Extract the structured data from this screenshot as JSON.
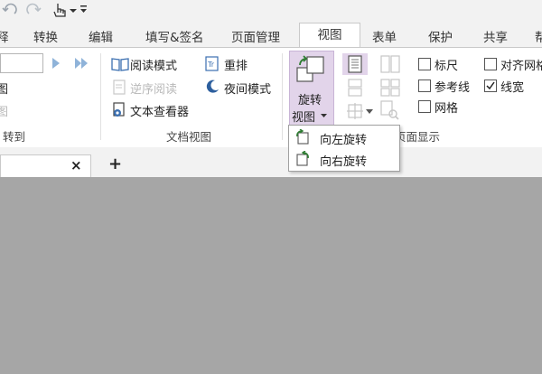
{
  "quick_access": {
    "icons": [
      "undo-icon",
      "redo-icon",
      "hand-tool-icon",
      "customize-arrow-icon"
    ]
  },
  "tabs": [
    {
      "label": "释"
    },
    {
      "label": "转换"
    },
    {
      "label": "编辑"
    },
    {
      "label": "填写&签名"
    },
    {
      "label": "页面管理"
    },
    {
      "label": "视图",
      "active": true
    },
    {
      "label": "表单"
    },
    {
      "label": "保护"
    },
    {
      "label": "共享"
    },
    {
      "label": "帮"
    }
  ],
  "ribbon": {
    "goto": {
      "page_input_value": "",
      "item1": "图",
      "item2": "图",
      "group_label": "转到"
    },
    "doc_view": {
      "read_mode": "阅读模式",
      "reverse_read": "逆序阅读",
      "text_viewer": "文本查看器",
      "reflow": "重排",
      "night_mode": "夜间模式",
      "group_label": "文档视图"
    },
    "rotate": {
      "label_line1": "旋转",
      "label_line2": "视图"
    },
    "page_display": {
      "group_label": "页面显示",
      "ruler": "标尺",
      "guides": "参考线",
      "grid": "网格",
      "align_grid": "对齐网格",
      "line_weight": "线宽",
      "line_weight_checked": true
    }
  },
  "rotate_menu": {
    "items": [
      "向左旋转",
      "向右旋转"
    ]
  },
  "document_tabs": {
    "close_symbol": "×",
    "new_tab_symbol": "+"
  },
  "colors": {
    "ribbon_bg": "#ffffff",
    "chrome_bg": "#f2f2f2",
    "workspace_bg": "#a6a6a6",
    "rotate_highlight": "#e2d4ea"
  }
}
